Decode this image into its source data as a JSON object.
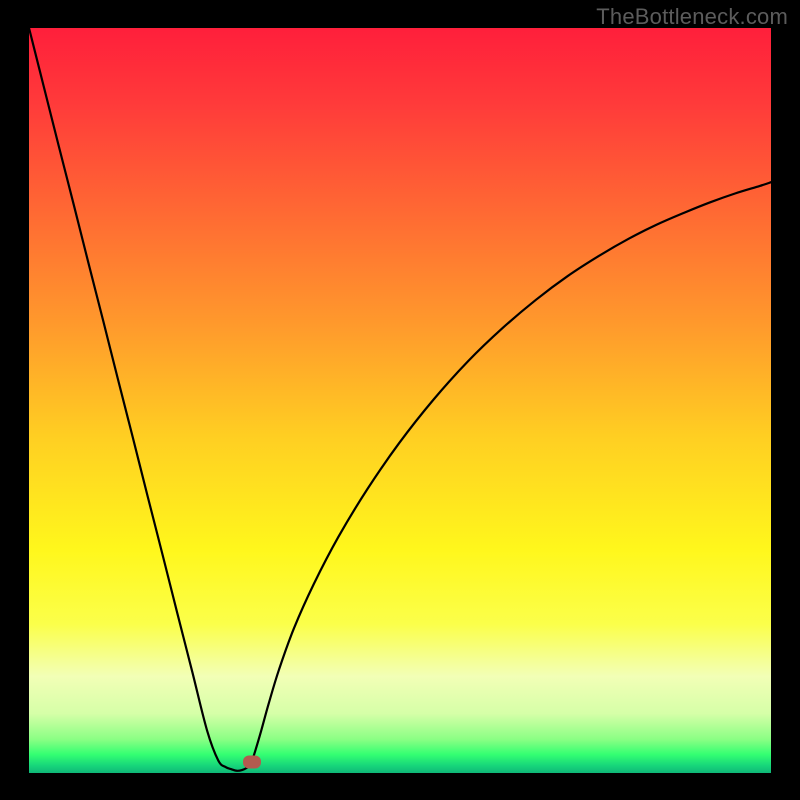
{
  "watermark": "TheBottleneck.com",
  "colors": {
    "frame": "#000000",
    "gradient_stops": [
      {
        "offset": 0.0,
        "color": "#ff1f3b"
      },
      {
        "offset": 0.1,
        "color": "#ff3a3a"
      },
      {
        "offset": 0.25,
        "color": "#ff6a33"
      },
      {
        "offset": 0.4,
        "color": "#ff9a2c"
      },
      {
        "offset": 0.55,
        "color": "#ffcf22"
      },
      {
        "offset": 0.7,
        "color": "#fff71c"
      },
      {
        "offset": 0.8,
        "color": "#fbff4a"
      },
      {
        "offset": 0.87,
        "color": "#f2ffb6"
      },
      {
        "offset": 0.92,
        "color": "#d6ffa8"
      },
      {
        "offset": 0.955,
        "color": "#8aff84"
      },
      {
        "offset": 0.975,
        "color": "#34ff72"
      },
      {
        "offset": 0.99,
        "color": "#17d67a"
      },
      {
        "offset": 1.0,
        "color": "#0fb778"
      }
    ],
    "curve": "#000000",
    "marker": "#b35a4f"
  },
  "chart_data": {
    "type": "line",
    "title": "",
    "xlabel": "",
    "ylabel": "",
    "xlim": [
      0,
      100
    ],
    "ylim": [
      0,
      100
    ],
    "grid": false,
    "series": [
      {
        "name": "bottleneck-curve",
        "x": [
          0,
          2,
          4,
          6,
          8,
          10,
          12,
          14,
          16,
          18,
          20,
          22,
          24,
          25.5,
          26.5,
          27.3,
          28,
          28.7,
          29.5,
          30,
          30.5,
          31.3,
          32.3,
          33.7,
          35.7,
          38.4,
          41.7,
          45.6,
          49.9,
          54.5,
          59.2,
          63.8,
          68.3,
          72.6,
          76.8,
          80.8,
          84.6,
          88.3,
          91.8,
          95.2,
          98.5,
          100
        ],
        "y": [
          100,
          92.1,
          84.2,
          76.4,
          68.5,
          60.7,
          52.8,
          45.0,
          37.1,
          29.3,
          21.4,
          13.6,
          5.7,
          1.7,
          0.8,
          0.5,
          0.3,
          0.4,
          0.8,
          1.5,
          3.0,
          5.7,
          9.3,
          13.9,
          19.4,
          25.4,
          31.7,
          38.1,
          44.3,
          50.1,
          55.3,
          59.7,
          63.5,
          66.7,
          69.4,
          71.7,
          73.6,
          75.2,
          76.6,
          77.8,
          78.8,
          79.3
        ]
      }
    ],
    "annotations": [
      {
        "name": "red-marker",
        "x": 30,
        "y": 1.5
      }
    ]
  }
}
